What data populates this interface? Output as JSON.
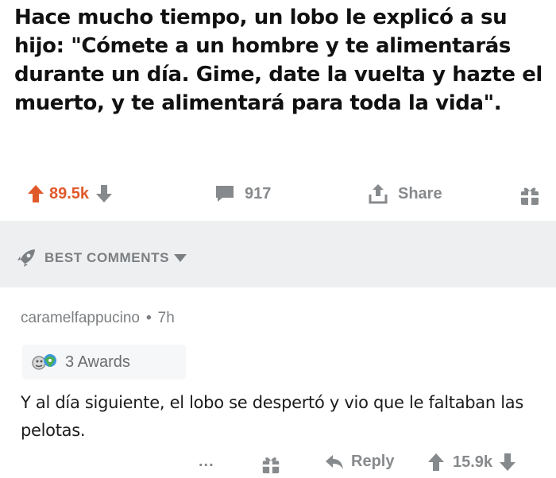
{
  "caption": "Hace mucho tiempo, un lobo le explicó a su hijo: \"Cómete a un hombre y te alimentarás durante un día. Gime, date la vuelta y hazte el muerto, y te alimentará para toda la vida\".",
  "post": {
    "upvotes": "89.5k",
    "comments": "917",
    "share_label": "Share",
    "accent_color": "#e0592a"
  },
  "sort": {
    "label": "BEST COMMENTS"
  },
  "comment": {
    "username": "caramelfappucino",
    "separator": "•",
    "age": "7h",
    "awards_label": "3 Awards",
    "text": "Y al día siguiente, el lobo se despertó y vio que le faltaban las pelotas.",
    "more_label": "...",
    "reply_label": "Reply",
    "score": "15.9k"
  },
  "icons": [
    "upvote-icon",
    "downvote-icon",
    "comment-icon",
    "share-icon",
    "gift-icon",
    "rocket-icon",
    "chevron-down-icon",
    "award-icon",
    "reply-icon"
  ]
}
